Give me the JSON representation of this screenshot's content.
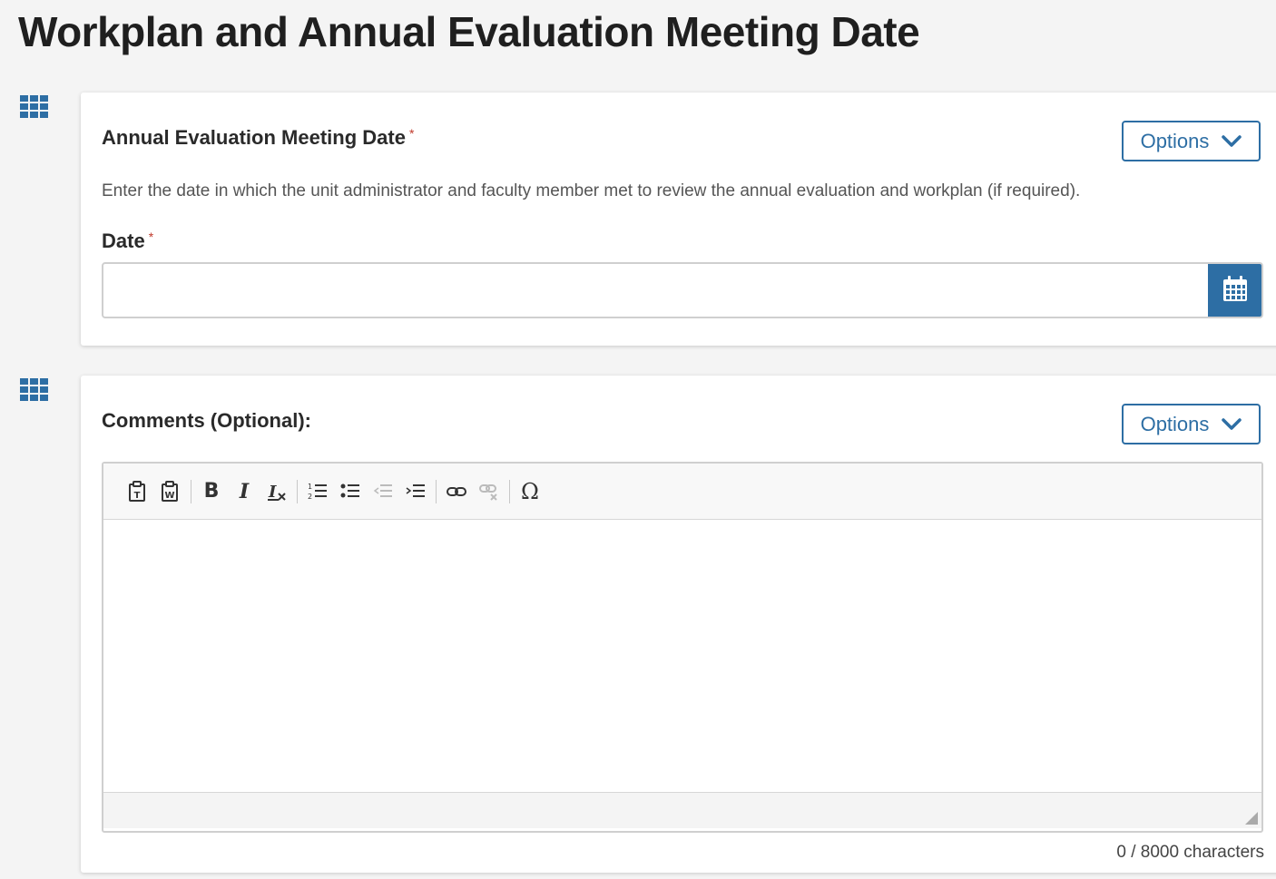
{
  "page": {
    "title": "Workplan and Annual Evaluation Meeting Date"
  },
  "colors": {
    "accent": "#2d6ea4",
    "required": "#c0392b"
  },
  "section1": {
    "icon": "grid-icon",
    "title": "Annual Evaluation Meeting Date",
    "required_mark": "*",
    "options_label": "Options",
    "helper_text": "Enter the date in which the unit administrator and faculty member met to review the annual evaluation and workplan (if required).",
    "date_label": "Date",
    "date_required_mark": "*",
    "date_value": "",
    "calendar_icon": "calendar-icon"
  },
  "section2": {
    "icon": "grid-icon",
    "title": "Comments (Optional):",
    "options_label": "Options",
    "toolbar": {
      "bold": "B",
      "italic": "I",
      "special_char": "Ω"
    },
    "char_count": "0 / 8000 characters"
  }
}
